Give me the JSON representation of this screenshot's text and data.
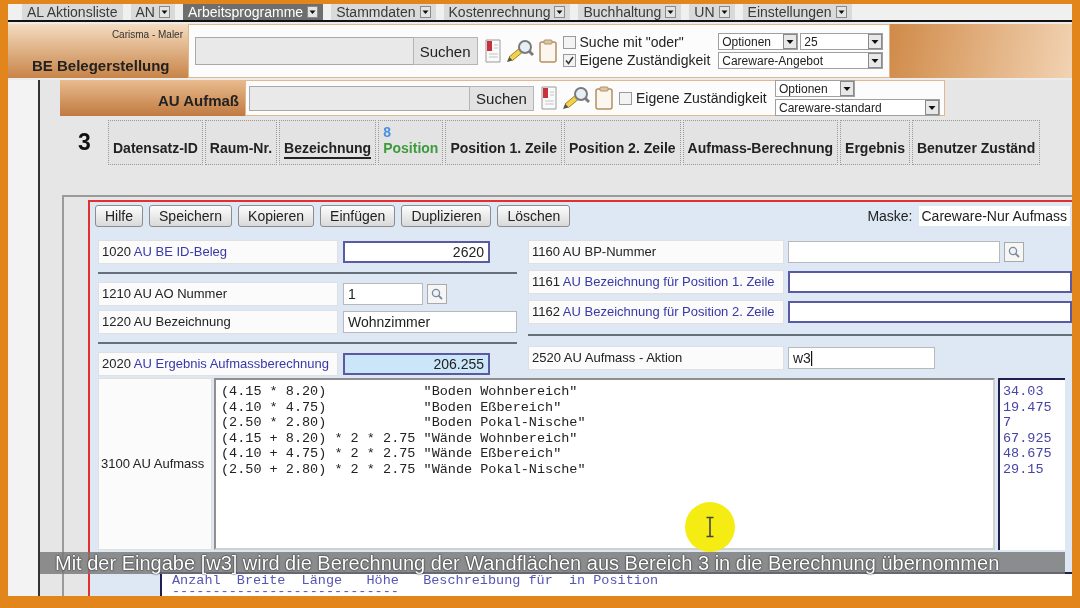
{
  "menu_bar": {
    "items": [
      {
        "label": "AL Aktionsliste",
        "dropdown": false,
        "selected": false
      },
      {
        "label": "AN",
        "dropdown": true,
        "selected": false
      },
      {
        "label": "Arbeitsprogramme",
        "dropdown": true,
        "selected": true
      },
      {
        "label": "Stammdaten",
        "dropdown": true,
        "selected": false
      },
      {
        "label": "Kostenrechnung",
        "dropdown": true,
        "selected": false
      },
      {
        "label": "Buchhaltung",
        "dropdown": true,
        "selected": false
      },
      {
        "label": "UN",
        "dropdown": true,
        "selected": false
      },
      {
        "label": "Einstellungen",
        "dropdown": true,
        "selected": false
      }
    ]
  },
  "search_panels": [
    {
      "kind": "main",
      "caption": "Carisma - Maler",
      "title": "BE Belegerstellung",
      "search_button": "Suchen",
      "checkboxes": [
        {
          "label": "Suche mit \"oder\"",
          "checked": false
        },
        {
          "label": "Eigene Zuständigkeit",
          "checked": true
        }
      ],
      "selects": [
        [
          {
            "value": "Optionen"
          },
          {
            "value": "25"
          }
        ],
        [
          {
            "value": "Careware-Angebot"
          }
        ]
      ]
    },
    {
      "kind": "sub",
      "title": "AU Aufmaß",
      "search_button": "Suchen",
      "checkboxes": [
        {
          "label": "Eigene Zuständigkeit",
          "checked": false
        }
      ],
      "selects": [
        [
          {
            "value": "Optionen"
          }
        ],
        [
          {
            "value": "Careware-standard"
          }
        ]
      ]
    }
  ],
  "record_count": "3",
  "columns": [
    {
      "label": "Datensatz-ID",
      "sorted": false,
      "highlighted": false
    },
    {
      "label": "Raum-Nr.",
      "sorted": false,
      "highlighted": false
    },
    {
      "label": "Bezeichnung",
      "sorted": true,
      "highlighted": false
    },
    {
      "label": "Position",
      "count": "8",
      "sorted": false,
      "highlighted": true
    },
    {
      "label": "Position 1. Zeile",
      "sorted": false,
      "highlighted": false
    },
    {
      "label": "Position 2. Zeile",
      "sorted": false,
      "highlighted": false
    },
    {
      "label": "Aufmass-Berechnung",
      "sorted": false,
      "highlighted": false
    },
    {
      "label": "Ergebnis",
      "sorted": false,
      "highlighted": false
    },
    {
      "label": "Benutzer Zuständ",
      "sorted": false,
      "highlighted": false
    }
  ],
  "form": {
    "toolbar": [
      "Hilfe",
      "Speichern",
      "Kopieren",
      "Einfügen",
      "Duplizieren",
      "Löschen"
    ],
    "mask": {
      "label": "Maske:",
      "value": "Careware-Nur Aufmass"
    },
    "field_columns": [
      [
        [
          {
            "number": "1020",
            "label": "AU BE ID-Beleg",
            "kind": "number",
            "value": "2620",
            "linked": true,
            "computed": false,
            "focused": false
          }
        ],
        [
          {
            "number": "1210",
            "label": "AU AO Nummer",
            "kind": "lookup",
            "value": "1",
            "linked": false,
            "computed": false,
            "focused": false
          },
          {
            "number": "1220",
            "label": "AU Bezeichnung",
            "kind": "text",
            "value": "Wohnzimmer",
            "linked": false,
            "computed": false,
            "focused": false
          }
        ],
        [
          {
            "number": "2020",
            "label": "AU Ergebnis Aufmassberechnung",
            "kind": "number",
            "value": "206.255",
            "linked": true,
            "computed": true,
            "focused": false
          }
        ]
      ],
      [
        [
          {
            "number": "1160",
            "label": "AU BP-Nummer",
            "kind": "lookup",
            "linked": false,
            "computed": false,
            "focused": false
          },
          {
            "number": "1161",
            "label": "AU Bezeichnung für Position 1. Zeile",
            "kind": "text",
            "linked": true,
            "computed": false,
            "focused": false
          },
          {
            "number": "1162",
            "label": "AU Bezeichnung für Position 2. Zeile",
            "kind": "text",
            "linked": true,
            "computed": false,
            "focused": false
          }
        ],
        [
          {
            "number": "2520",
            "label": "AU Aufmass - Aktion",
            "kind": "short",
            "value": "w3",
            "linked": false,
            "computed": false,
            "focused": true
          }
        ]
      ]
    ],
    "aufmass": {
      "number": "3100",
      "label": "AU Aufmass",
      "lines": [
        "(4.15 * 8.20)            \"Boden Wohnbereich\"",
        "(4.10 * 4.75)            \"Boden Eßbereich\"",
        "(2.50 * 2.80)            \"Boden Pokal-Nische\"",
        "(4.15 + 8.20) * 2 * 2.75 \"Wände Wohnbereich\"",
        "(4.10 + 4.75) * 2 * 2.75 \"Wände Eßbereich\"",
        "(2.50 + 2.80) * 2 * 2.75 \"Wände Pokal-Nische\""
      ],
      "results": [
        "34.03",
        "19.475",
        "7",
        "67.925",
        "48.675",
        "29.15"
      ]
    },
    "help": {
      "header": "Anzahl  Breite  Länge   Höhe   Beschreibung für  in Position",
      "rule": "----------------------------"
    }
  },
  "subtitle": "Mit der Eingabe [w3] wird die Berechnung der Wandflächen aus Bereich 3 in die Berechnung übernommen"
}
